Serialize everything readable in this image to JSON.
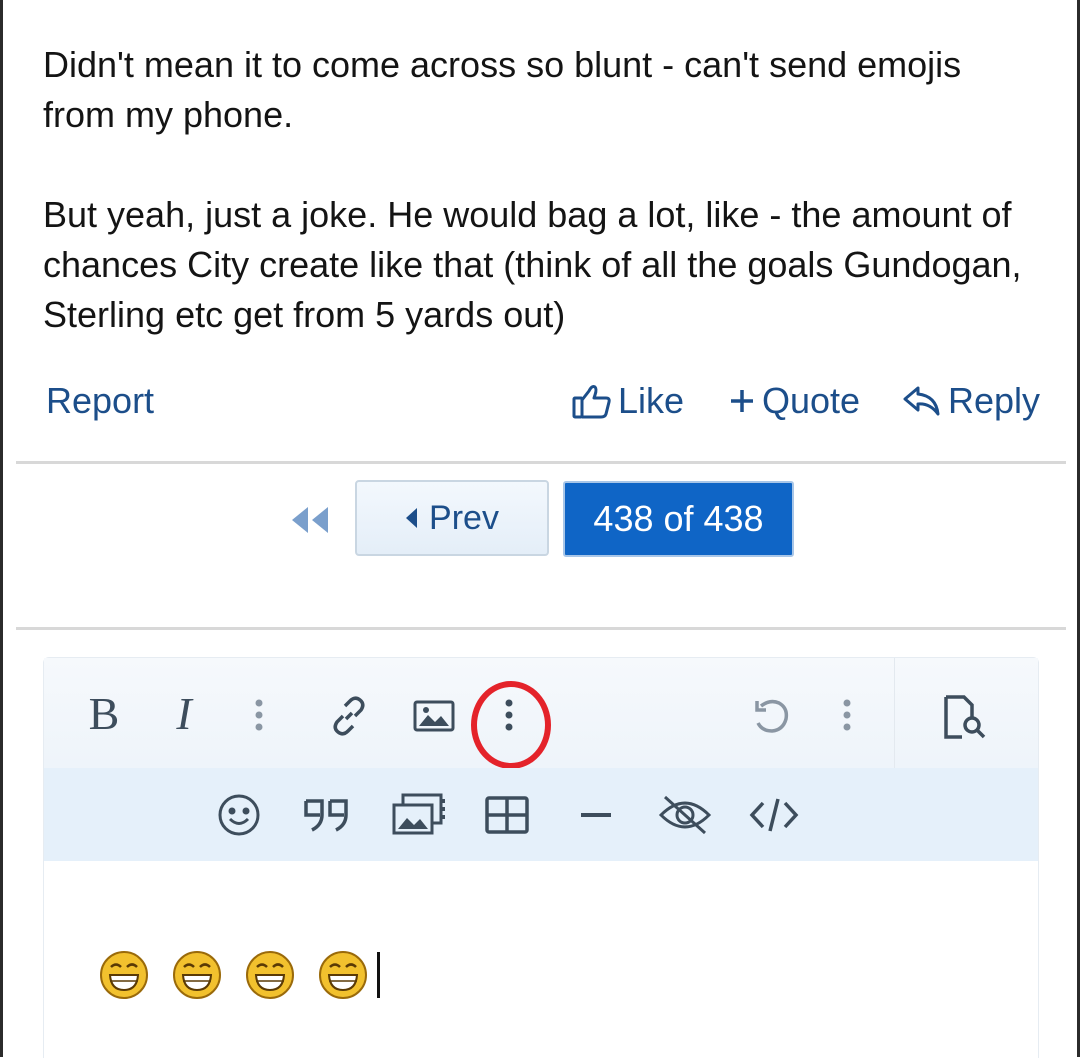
{
  "post": {
    "paragraphs": [
      "Didn't mean it to come across so blunt - can't send emojis from my phone.",
      "But yeah, just a joke. He would bag a lot, like - the amount of chances City create like that (think of all the goals Gundogan, Sterling etc get from 5 yards out)"
    ]
  },
  "actions": {
    "report": "Report",
    "like": "Like",
    "quote": "Quote",
    "reply": "Reply"
  },
  "pagination": {
    "prev": "Prev",
    "current": "438 of 438"
  },
  "editor": {
    "toolbar_primary": [
      "bold-icon",
      "italic-icon",
      "more-text-options-icon",
      "link-icon",
      "insert-image-icon",
      "more-insert-options-icon",
      "undo-icon",
      "more-options-icon",
      "preview-icon"
    ],
    "toolbar_secondary": [
      "smilie-icon",
      "quote-icon",
      "media-icon",
      "table-icon",
      "horizontal-rule-icon",
      "spoiler-icon",
      "code-icon"
    ],
    "bold_label": "B",
    "italic_label": "I",
    "content_emojis": 4,
    "highlight_color": "#e4232a",
    "accent_color": "#0f65c6",
    "link_color": "#1c4e8a"
  }
}
